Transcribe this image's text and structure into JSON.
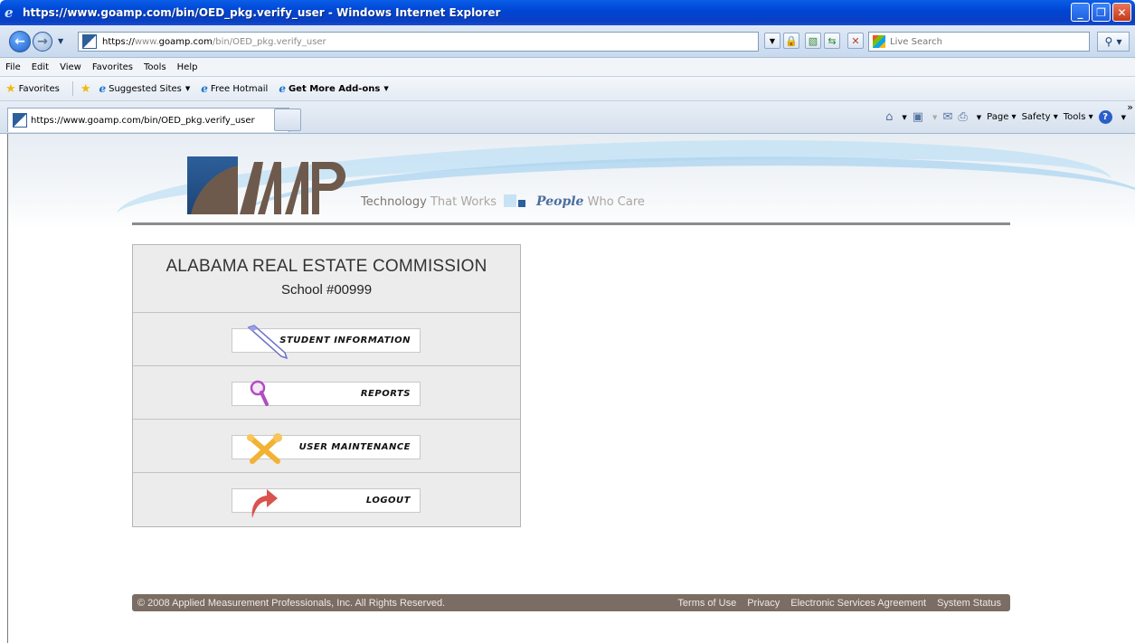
{
  "window": {
    "title": "https://www.goamp.com/bin/OED_pkg.verify_user - Windows Internet Explorer"
  },
  "address_bar": {
    "url_prefix": "https://",
    "url_domain_pre": "www.",
    "url_domain": "goamp.com",
    "url_path": "/bin/OED_pkg.verify_user"
  },
  "search": {
    "placeholder": "Live Search"
  },
  "menu": {
    "items": [
      "File",
      "Edit",
      "View",
      "Favorites",
      "Tools",
      "Help"
    ]
  },
  "favorites_bar": {
    "favorites_label": "Favorites",
    "suggested_sites": "Suggested Sites",
    "free_hotmail": "Free Hotmail",
    "get_addons": "Get More Add-ons"
  },
  "tab": {
    "label": "https://www.goamp.com/bin/OED_pkg.verify_user"
  },
  "command_bar": {
    "page": "Page",
    "safety": "Safety",
    "tools": "Tools"
  },
  "banner": {
    "tagline_strong": "Technology",
    "tagline_light": "That Works",
    "tagline_people": "People",
    "tagline_end": "Who Care"
  },
  "panel": {
    "organization": "ALABAMA REAL ESTATE COMMISSION",
    "school": "School #00999",
    "buttons": [
      {
        "label": "STUDENT INFORMATION",
        "icon": "pen-icon"
      },
      {
        "label": "REPORTS",
        "icon": "magnifier-icon"
      },
      {
        "label": "USER MAINTENANCE",
        "icon": "tools-icon"
      },
      {
        "label": "LOGOUT",
        "icon": "logout-arrow-icon"
      }
    ]
  },
  "footer": {
    "copyright": "© 2008 Applied Measurement Professionals, Inc. All Rights Reserved.",
    "links": [
      "Terms of Use",
      "Privacy",
      "Electronic Services Agreement",
      "System Status"
    ]
  },
  "colors": {
    "footer_bg": "#7b6d63",
    "logo_brown": "#6e5a4c",
    "logo_blue": "#2d5f9a",
    "titlebar_blue": "#0046d5"
  }
}
